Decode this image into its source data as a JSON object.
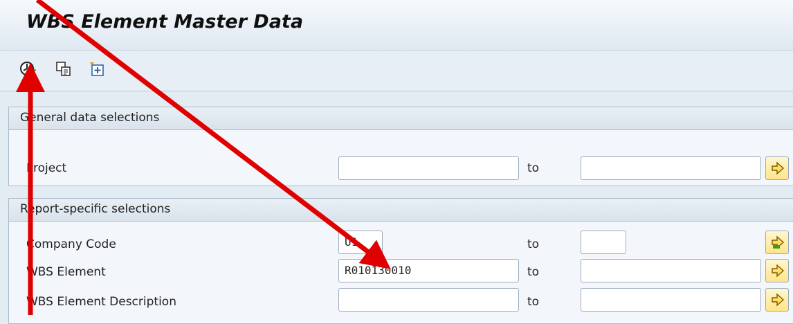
{
  "window": {
    "title": "WBS Element Master Data"
  },
  "toolbar": {
    "icons": [
      "execute-clock-icon",
      "copy-variant-icon",
      "multiple-selection-icon"
    ]
  },
  "general_section": {
    "title": "General data selections",
    "rows": [
      {
        "label": "Project",
        "from": "",
        "to_label": "to",
        "to_value": ""
      }
    ]
  },
  "report_section": {
    "title": "Report-specific selections",
    "rows": [
      {
        "label": "Company Code",
        "from": "U1",
        "to_label": "to",
        "to_value": ""
      },
      {
        "label": "WBS Element",
        "from": "R010130010",
        "to_label": "to",
        "to_value": ""
      },
      {
        "label": "WBS Element Description",
        "from": "",
        "to_label": "to",
        "to_value": ""
      }
    ]
  },
  "colors": {
    "annotation": "#e00000",
    "arrow_button_bg": "#ffe48a",
    "arrow_green": "#3a9d1e"
  }
}
